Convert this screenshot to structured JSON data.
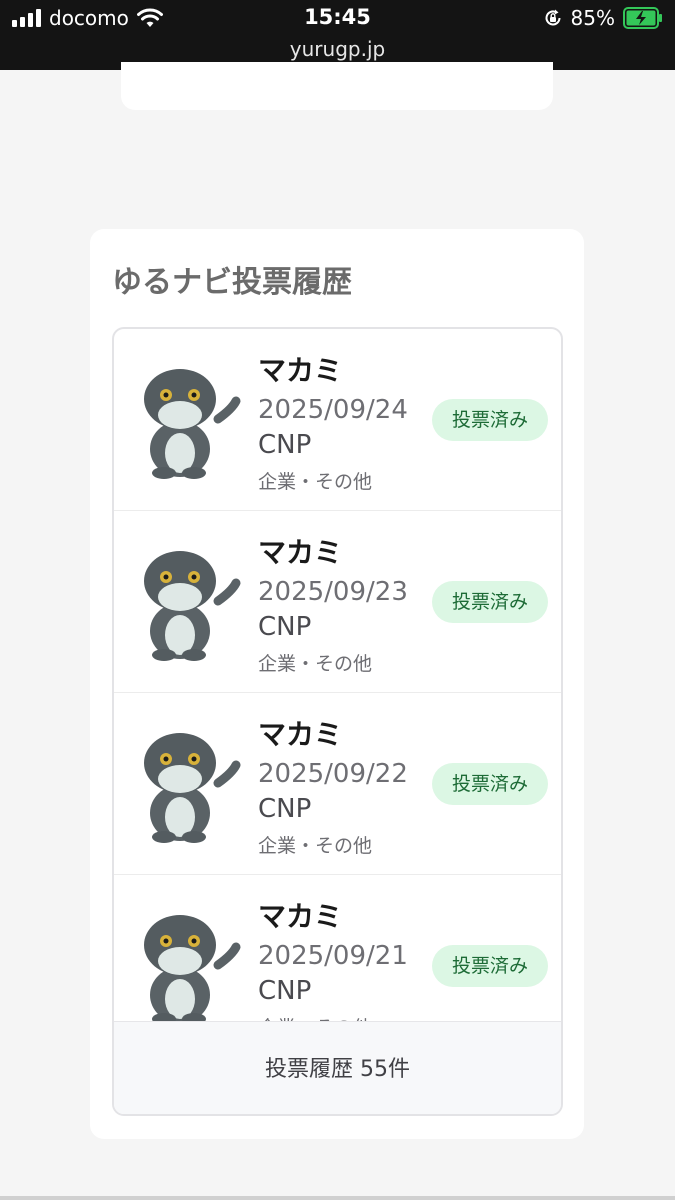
{
  "status_bar": {
    "carrier": "docomo",
    "time": "15:45",
    "battery": "85%",
    "url": "yurugp.jp"
  },
  "section": {
    "title": "ゆるナビ投票履歴"
  },
  "votes": [
    {
      "name": "マカミ",
      "date": "2025/09/24",
      "org": "CNP",
      "category": "企業・その他",
      "status": "投票済み"
    },
    {
      "name": "マカミ",
      "date": "2025/09/23",
      "org": "CNP",
      "category": "企業・その他",
      "status": "投票済み"
    },
    {
      "name": "マカミ",
      "date": "2025/09/22",
      "org": "CNP",
      "category": "企業・その他",
      "status": "投票済み"
    },
    {
      "name": "マカミ",
      "date": "2025/09/21",
      "org": "CNP",
      "category": "企業・その他",
      "status": "投票済み"
    }
  ],
  "footer": {
    "label": "投票履歴 55件"
  },
  "colors": {
    "badge_bg": "#dcf7e4",
    "badge_text": "#1d6b36",
    "statusbar_bg": "#141414",
    "battery_green": "#34c759"
  },
  "icons": [
    "signal-icon",
    "wifi-icon",
    "rotation-lock-icon",
    "battery-icon",
    "mascot-image"
  ]
}
